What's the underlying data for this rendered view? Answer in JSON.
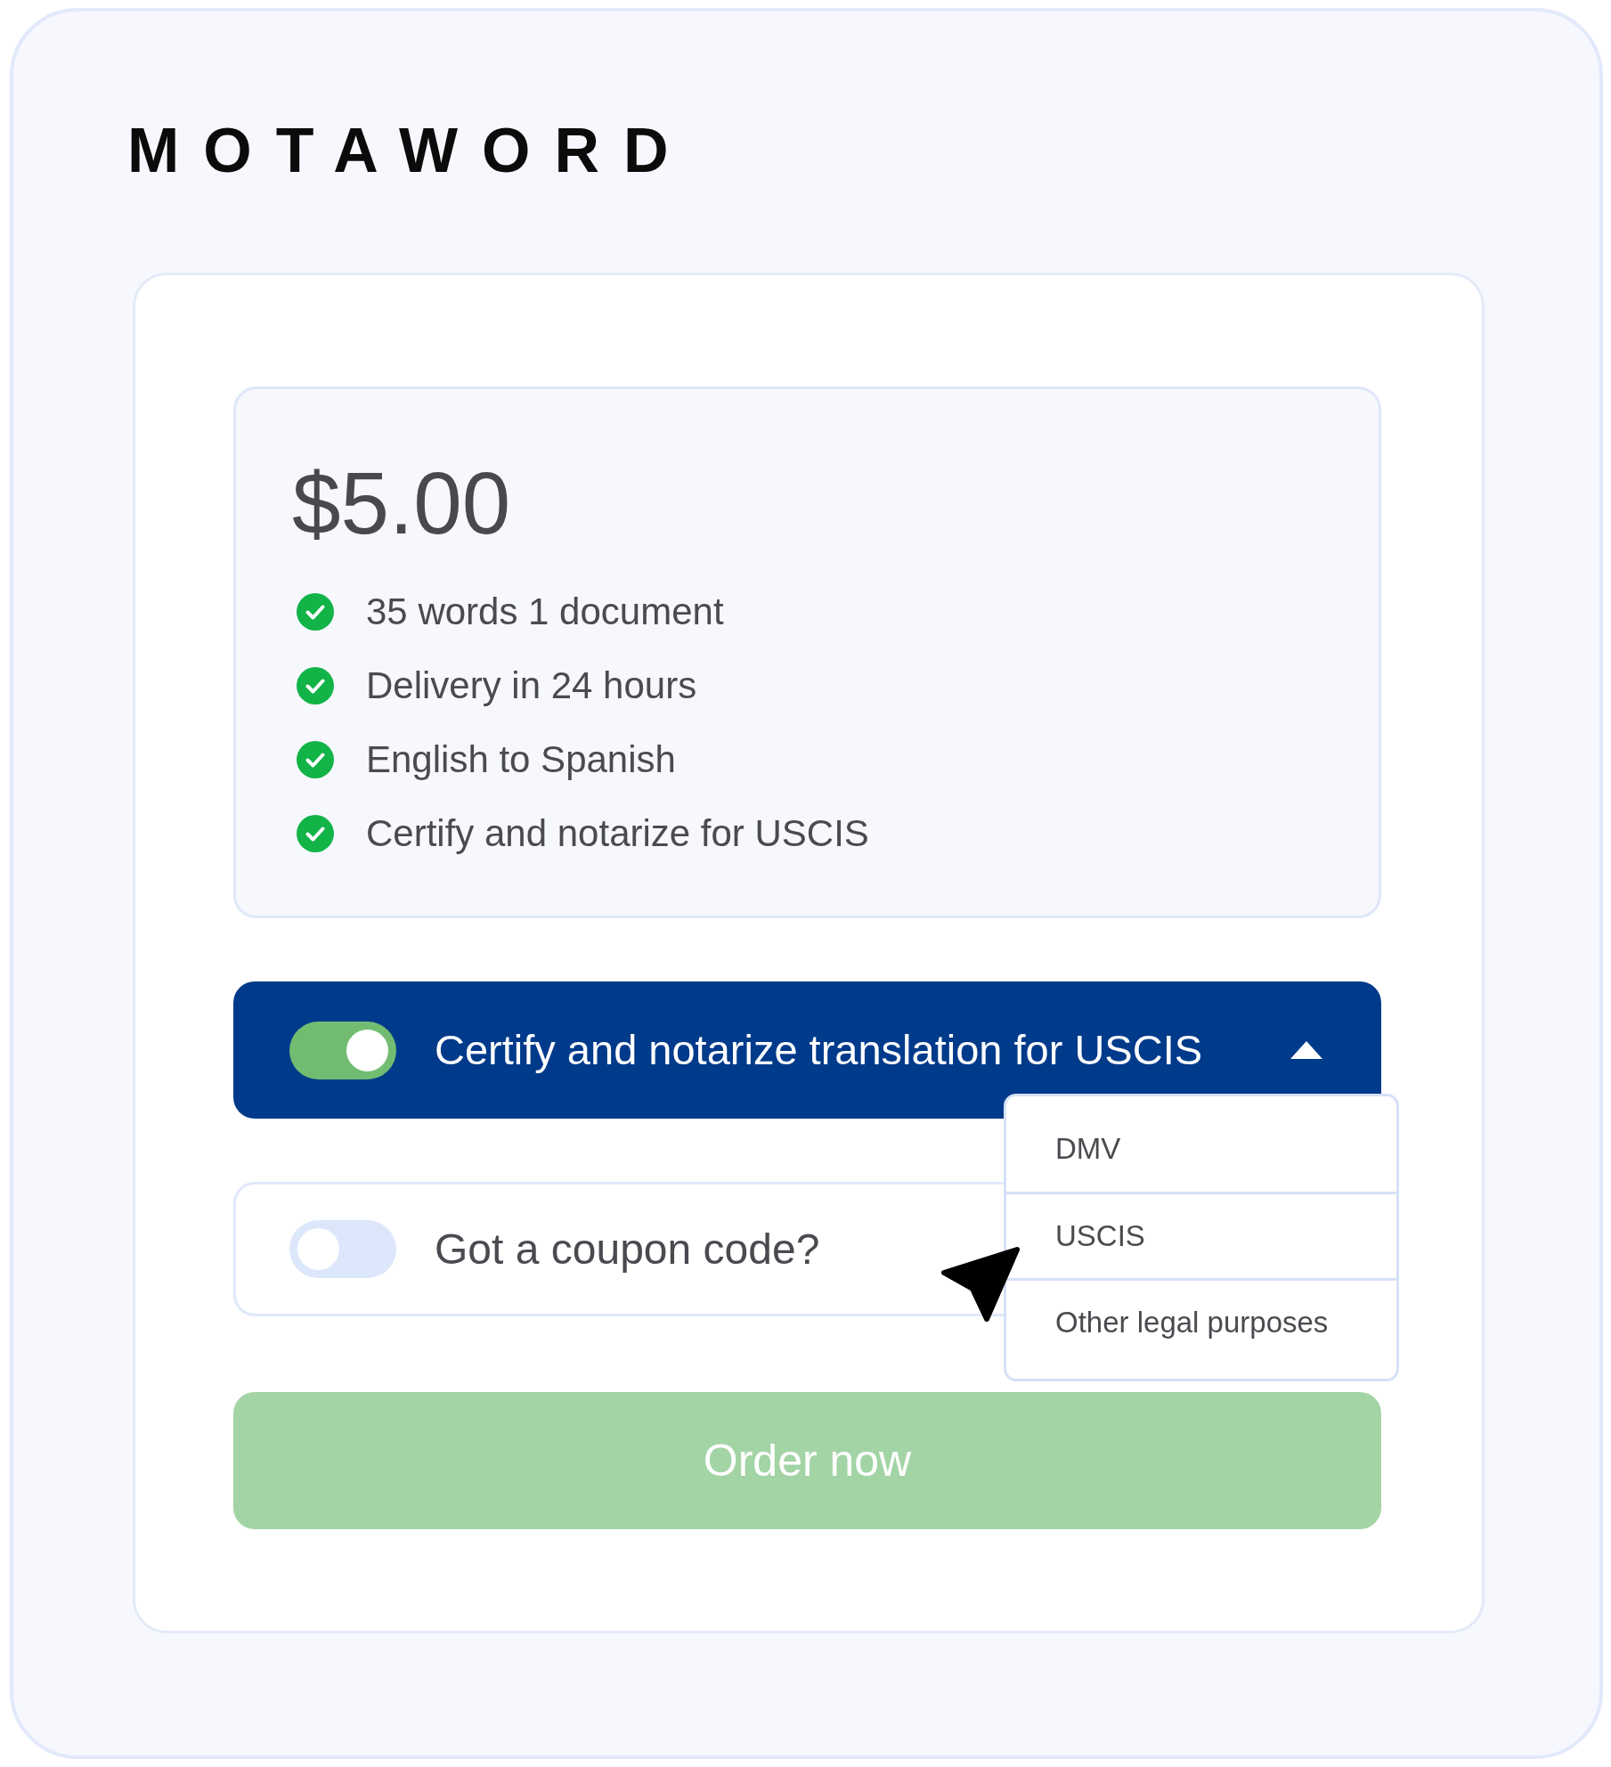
{
  "logo": "MOTAWORD",
  "price_summary": {
    "price": "$5.00",
    "features": [
      "35 words 1 document",
      "Delivery in 24 hours",
      "English to Spanish",
      "Certify and notarize for USCIS"
    ]
  },
  "certify_option": {
    "label": "Certify and notarize translation for USCIS",
    "on": true,
    "expanded": true,
    "options": [
      {
        "label": "DMV",
        "selected": false
      },
      {
        "label": "USCIS",
        "selected": false
      },
      {
        "label": "Other legal purposes",
        "selected": false
      }
    ]
  },
  "coupon_option": {
    "label": "Got a coupon code?",
    "on": false
  },
  "order_button": {
    "label": "Order now"
  }
}
